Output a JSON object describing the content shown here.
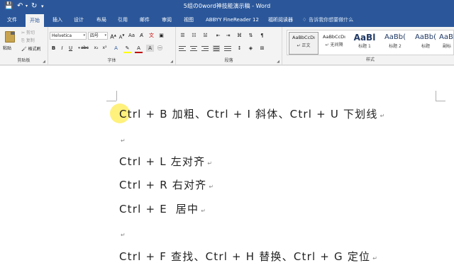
{
  "window": {
    "title": "5组の0word神技能演示稿 - Word"
  },
  "tabs": [
    "文件",
    "开始",
    "插入",
    "设计",
    "布局",
    "引用",
    "邮件",
    "审阅",
    "视图",
    "ABBYY FineReader 12",
    "福昕阅读器"
  ],
  "active_tab": "开始",
  "tell_me": "告诉我你想要做什么",
  "ribbon": {
    "clipboard": {
      "paste": "粘贴",
      "cut": "剪切",
      "copy": "复制",
      "format_painter": "格式刷",
      "label": "剪贴板"
    },
    "font": {
      "font_name": "Helvetica",
      "font_size": "四号",
      "label": "字体"
    },
    "paragraph": {
      "label": "段落"
    },
    "styles": {
      "label": "样式",
      "items": [
        {
          "sample": "AaBbCcDı",
          "name": "正文"
        },
        {
          "sample": "AaBbCcDı",
          "name": "无间隔"
        },
        {
          "sample": "AaBl",
          "name": "标题 1"
        },
        {
          "sample": "AaBb(",
          "name": "标题 2"
        },
        {
          "sample": "AaBb(",
          "name": "标题"
        },
        {
          "sample": "AaBb(",
          "name": "副标"
        }
      ]
    }
  },
  "document": {
    "lines": [
      "Ctrl + B 加粗、Ctrl + I 斜体、Ctrl + U 下划线",
      "Ctrl + L 左对齐",
      "Ctrl + R 右对齐",
      "Ctrl + E  居中",
      "Ctrl + F 查找、Ctrl + H 替换、Ctrl + G 定位"
    ],
    "paragraph_mark": "↵"
  }
}
